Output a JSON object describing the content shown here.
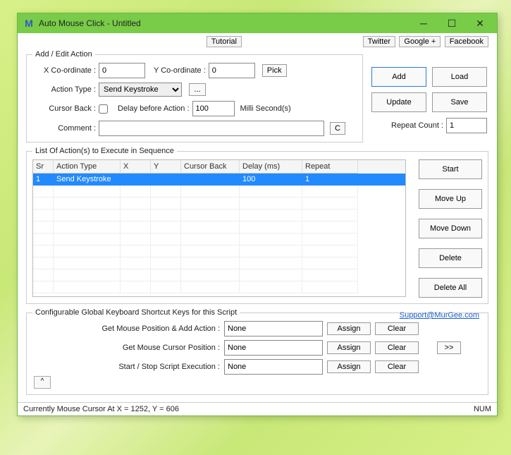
{
  "window": {
    "icon_letter": "M",
    "title": "Auto Mouse Click - Untitled"
  },
  "toolbar_links": {
    "tutorial": "Tutorial",
    "twitter": "Twitter",
    "google": "Google +",
    "facebook": "Facebook"
  },
  "addedit": {
    "legend": "Add / Edit Action",
    "x_label": "X Co-ordinate :",
    "x_value": "0",
    "y_label": "Y Co-ordinate :",
    "y_value": "0",
    "pick": "Pick",
    "action_type_label": "Action Type :",
    "action_type_value": "Send Keystroke",
    "ellipsis": "...",
    "cursor_back_label": "Cursor Back :",
    "delay_label": "Delay before Action :",
    "delay_value": "100",
    "delay_unit": "Milli Second(s)",
    "comment_label": "Comment :",
    "comment_value": "",
    "c_btn": "C",
    "repeat_label": "Repeat Count :",
    "repeat_value": "1"
  },
  "side_actions": {
    "add": "Add",
    "load": "Load",
    "update": "Update",
    "save": "Save"
  },
  "list": {
    "legend": "List Of Action(s) to Execute in Sequence",
    "headers": {
      "sr": "Sr",
      "action": "Action Type",
      "x": "X",
      "y": "Y",
      "cb": "Cursor Back",
      "delay": "Delay (ms)",
      "repeat": "Repeat"
    },
    "rows": [
      {
        "sr": "1",
        "action": "Send Keystroke",
        "x": "",
        "y": "",
        "cb": "",
        "delay": "100",
        "repeat": "1"
      }
    ],
    "side": {
      "start": "Start",
      "moveup": "Move Up",
      "movedown": "Move Down",
      "delete": "Delete",
      "deleteall": "Delete All"
    }
  },
  "shortcuts": {
    "legend": "Configurable Global Keyboard Shortcut Keys for this Script",
    "support": "Support@MurGee.com",
    "row1_label": "Get Mouse Position & Add Action :",
    "row2_label": "Get Mouse Cursor Position :",
    "row3_label": "Start / Stop Script Execution :",
    "none": "None",
    "assign": "Assign",
    "clear": "Clear",
    "expand": ">>",
    "caret": "^"
  },
  "status": {
    "text": "Currently Mouse Cursor At X = 1252, Y = 606",
    "num": "NUM"
  }
}
